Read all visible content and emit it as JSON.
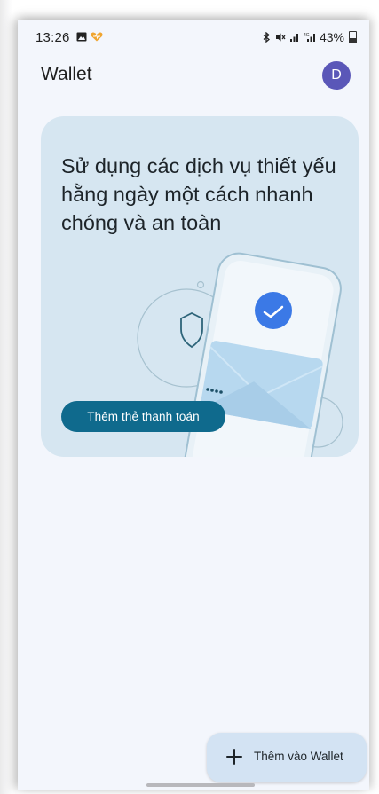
{
  "status_bar": {
    "time": "13:26",
    "battery_percent": "43%",
    "icons": [
      "image-icon",
      "heart-icon",
      "bluetooth-icon",
      "mute-icon",
      "signal-icon",
      "4g-signal-icon",
      "battery-icon"
    ]
  },
  "header": {
    "title": "Wallet",
    "avatar_letter": "D"
  },
  "promo": {
    "text": "Sử dụng các dịch vụ thiết yếu hằng ngày một cách nhanh chóng và an toàn",
    "button_label": "Thêm thẻ thanh toán"
  },
  "fab": {
    "label": "Thêm vào Wallet",
    "icon": "plus-icon"
  },
  "colors": {
    "background": "#f3f6fc",
    "card": "#d6e6f1",
    "primary_button": "#0f6a8d",
    "avatar": "#5a57b8",
    "check_circle": "#3b79e6",
    "fab": "#d3e3f3"
  }
}
